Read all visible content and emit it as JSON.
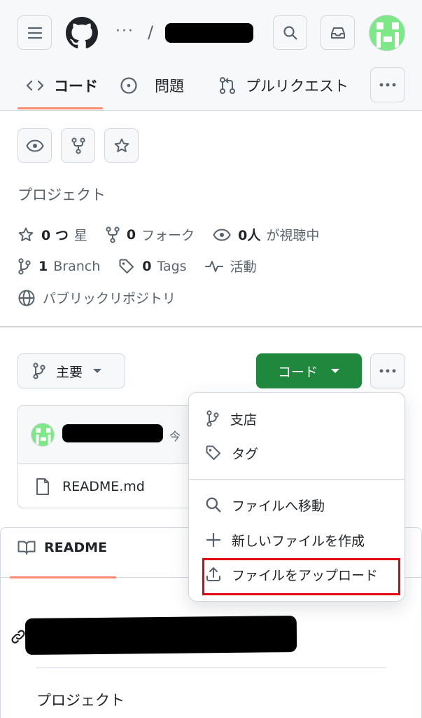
{
  "header": {
    "breadcrumb_ellipsis": "···",
    "breadcrumb_separator": "/"
  },
  "tabs": [
    {
      "label": "コード",
      "icon": "code-icon",
      "selected": true
    },
    {
      "label": "問題",
      "icon": "issue-icon"
    },
    {
      "label": "プルリクエスト",
      "icon": "pull-request-icon"
    }
  ],
  "repo": {
    "description": "プロジェクト",
    "stars_count": "0 つ",
    "stars_label": "星",
    "forks_count": "0",
    "forks_label": "フォーク",
    "watchers_count": "0人",
    "watchers_label": "が視聴中",
    "branches_count": "1",
    "branches_label": "Branch",
    "tags_count": "0",
    "tags_label": "Tags",
    "activity_label": "活動",
    "visibility": "パブリックリポジトリ"
  },
  "controls": {
    "branch_name": "主要",
    "code_button": "コード"
  },
  "filebox": {
    "commit_time": "今",
    "files": [
      "README.md"
    ]
  },
  "readme": {
    "tab_label": "README",
    "heading2": "プロジェクト"
  },
  "menu": {
    "items": [
      {
        "label": "支店",
        "icon": "branch-icon"
      },
      {
        "label": "タグ",
        "icon": "tag-icon"
      },
      {
        "label": "ファイルへ移動",
        "icon": "search-icon"
      },
      {
        "label": "新しいファイルを作成",
        "icon": "plus-icon"
      },
      {
        "label": "ファイルをアップロード",
        "icon": "upload-icon",
        "highlighted": true
      }
    ]
  },
  "colors": {
    "accent_underline": "#fd8c73",
    "code_button": "#1f883d",
    "highlight_border": "#e3000f",
    "avatar_green": "#7ee787"
  }
}
